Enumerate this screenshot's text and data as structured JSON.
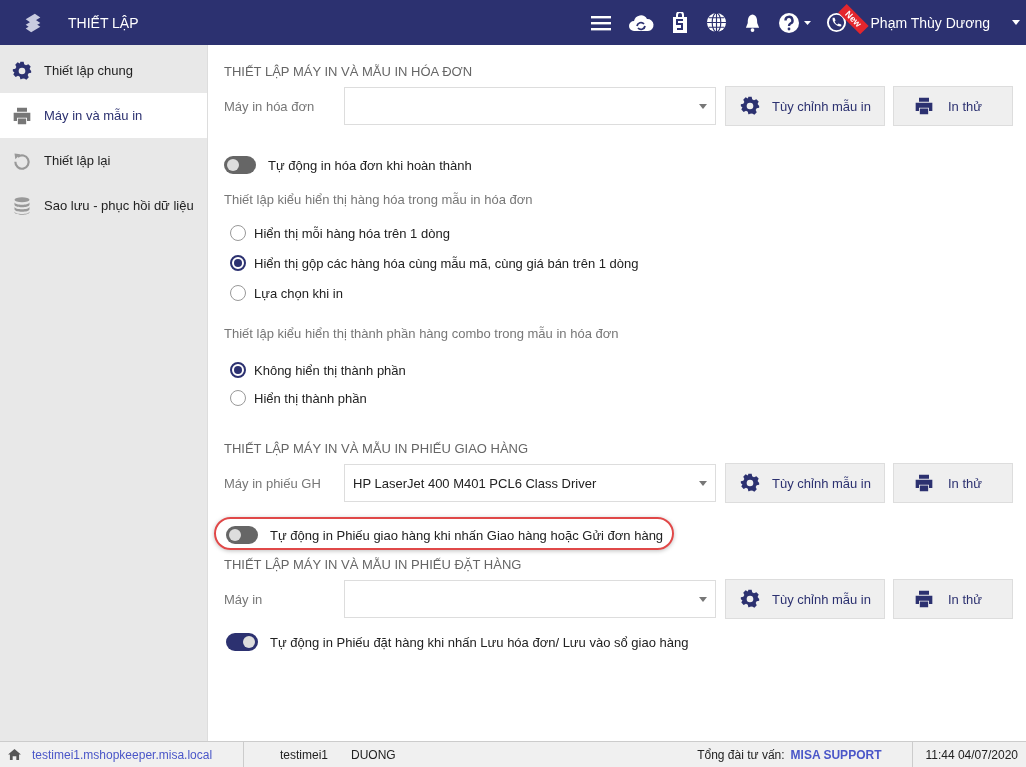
{
  "header": {
    "title": "THIẾT LẬP",
    "badge": "New",
    "user": "Phạm Thùy Dương"
  },
  "sidebar": {
    "items": [
      {
        "label": "Thiết lập chung",
        "selected": false,
        "kind": "gear"
      },
      {
        "label": "Máy in và mẫu in",
        "selected": true,
        "kind": "printer"
      },
      {
        "label": "Thiết lập lại",
        "selected": false,
        "kind": "reset"
      },
      {
        "label": "Sao lưu - phục hồi dữ liệu",
        "selected": false,
        "kind": "database"
      }
    ]
  },
  "sections": [
    {
      "heading": "THIẾT LẬP MÁY IN VÀ MẪU IN HÓA ĐƠN",
      "printer_label": "Máy in hóa đơn",
      "buttons": [
        "Tùy chỉnh mẫu in",
        "In thử"
      ],
      "toggles": [
        {
          "label": "Tự động in hóa đơn khi hoàn thành",
          "on": false,
          "highlighted": false
        }
      ],
      "option_groups": [
        {
          "title": "Thiết lập kiểu hiển thị hàng hóa trong mẫu in hóa đơn",
          "options": [
            {
              "label": "Hiển thị mỗi hàng hóa trên 1 dòng",
              "selected": false
            },
            {
              "label": "Hiển thị gộp các hàng hóa cùng mẫu mã, cùng giá bán trên 1 dòng",
              "selected": true
            },
            {
              "label": "Lựa chọn khi in",
              "selected": false
            }
          ]
        },
        {
          "title": "Thiết lập kiểu hiển thị thành phần hàng combo trong mẫu in hóa đơn",
          "options": [
            {
              "label": "Không hiển thị thành phần",
              "selected": true
            },
            {
              "label": "Hiển thị thành phần",
              "selected": false
            }
          ]
        }
      ]
    },
    {
      "heading": "THIẾT LẬP MÁY IN VÀ MẪU IN PHIẾU GIAO HÀNG",
      "printer_label": "Máy in phiếu GH",
      "printer_value": "HP LaserJet 400 M401 PCL6 Class Driver",
      "buttons": [
        "Tùy chỉnh mẫu in",
        "In thử"
      ],
      "toggles": [
        {
          "label": "Tự động in Phiếu giao hàng khi nhấn Giao hàng hoặc Gửi đơn hàng",
          "on": false,
          "highlighted": true
        }
      ]
    },
    {
      "heading": "THIẾT LẬP MÁY IN VÀ MẪU IN PHIẾU ĐẶT HÀNG",
      "printer_label": "Máy in",
      "buttons": [
        "Tùy chỉnh mẫu in",
        "In thử"
      ],
      "toggles": [
        {
          "label": "Tự động in Phiếu đặt hàng khi nhấn Lưu hóa đơn/ Lưu vào sổ giao hàng",
          "on": true,
          "highlighted": false
        }
      ]
    }
  ],
  "status_bar": {
    "host": "testimei1.mshopkeeper.misa.local",
    "user": "testimei1",
    "name": "DUONG",
    "hotline_label": "Tổng đài tư vấn:",
    "hotline": "MISA SUPPORT",
    "datetime": "11:44 04/07/2020"
  }
}
